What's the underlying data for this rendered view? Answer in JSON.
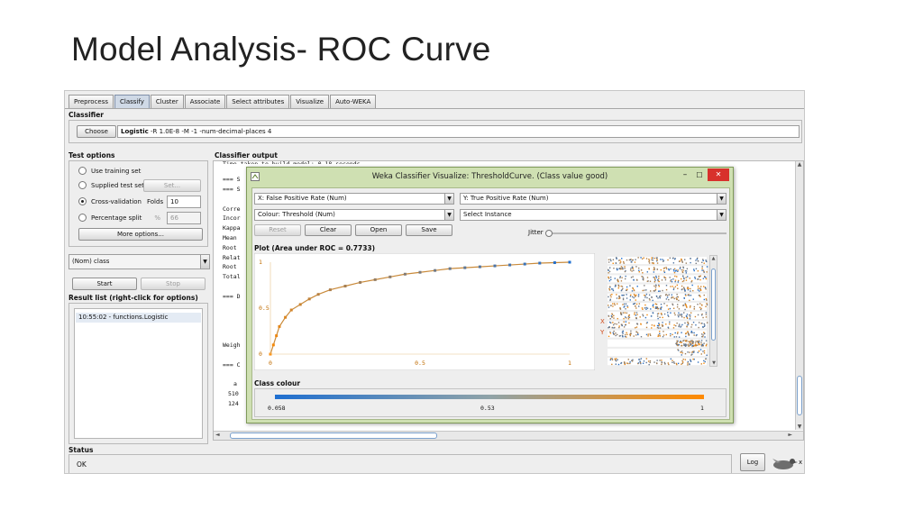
{
  "slide": {
    "title": "Model Analysis- ROC Curve"
  },
  "explorer": {
    "tabs": [
      "Preprocess",
      "Classify",
      "Cluster",
      "Associate",
      "Select attributes",
      "Visualize",
      "Auto-WEKA"
    ],
    "classifier": {
      "section_label": "Classifier",
      "choose_label": "Choose",
      "name": "Logistic",
      "options": " -R 1.0E-8 -M -1 -num-decimal-places 4"
    },
    "test_options": {
      "section_label": "Test options",
      "use_training": "Use training set",
      "supplied": "Supplied test set",
      "set_label": "Set...",
      "cross_validation": "Cross-validation",
      "folds_label": "Folds",
      "folds_value": "10",
      "percentage": "Percentage split",
      "percent_sign": "%",
      "percentage_value": "66",
      "more_options": "More options..."
    },
    "class_select": "(Nom) class",
    "start_label": "Start",
    "stop_label": "Stop",
    "result_list": {
      "section_label": "Result list (right-click for options)",
      "items": [
        "10:55:02 - functions.Logistic"
      ]
    },
    "output": {
      "section_label": "Classifier output",
      "lines": [
        "Time taken to build model: 0.18 seconds",
        "=== S",
        "=== S",
        "Corre",
        "Incor",
        "Kappa",
        "Mean ",
        "Root ",
        "Relat",
        "Root ",
        "Total",
        "=== D",
        "Weigh",
        "=== C",
        "a",
        "510",
        "124"
      ]
    },
    "status": {
      "section_label": "Status",
      "text": "OK",
      "log_label": "Log",
      "x_label": "x"
    }
  },
  "visualizer": {
    "title": "Weka Classifier Visualize: ThresholdCurve. (Class value good)",
    "x_axis_select": "X: False Positive Rate (Num)",
    "y_axis_select": "Y: True Positive Rate (Num)",
    "colour_select": "Colour: Threshold (Num)",
    "instance_select": "Select Instance",
    "buttons": {
      "reset": "Reset",
      "clear": "Clear",
      "open": "Open",
      "save": "Save"
    },
    "jitter_label": "Jitter",
    "plot_label": "Plot (Area under ROC = 0.7733)",
    "side_x": "X",
    "side_y": "Y",
    "class_colour_label": "Class colour",
    "colour_ticks": [
      "0.058",
      "0.53",
      "1"
    ],
    "minimize_glyph": "–",
    "maximize_glyph": "☐",
    "close_glyph": "✕",
    "colors": {
      "low": "#1f6fd0",
      "high": "#ff8a00",
      "close": "#d8312b"
    }
  },
  "chart_data": {
    "type": "scatter",
    "title": "Plot (Area under ROC = 0.7733)",
    "xlabel": "",
    "ylabel": "",
    "xlim": [
      0,
      1
    ],
    "ylim": [
      0,
      1
    ],
    "x_ticks": [
      "0",
      "0.5",
      "1"
    ],
    "y_ticks": [
      "0",
      "0.5",
      "1"
    ],
    "color_by": "Threshold",
    "color_range": [
      0.058,
      1
    ],
    "series": [
      {
        "x": [
          0.0,
          0.01,
          0.02,
          0.03,
          0.05,
          0.07,
          0.1,
          0.13,
          0.16,
          0.2,
          0.25,
          0.3,
          0.35,
          0.4,
          0.45,
          0.5,
          0.55,
          0.6,
          0.65,
          0.7,
          0.75,
          0.8,
          0.85,
          0.9,
          0.95,
          1.0
        ],
        "y": [
          0.0,
          0.1,
          0.2,
          0.3,
          0.4,
          0.48,
          0.54,
          0.6,
          0.65,
          0.7,
          0.74,
          0.78,
          0.81,
          0.84,
          0.87,
          0.89,
          0.91,
          0.93,
          0.94,
          0.95,
          0.96,
          0.97,
          0.98,
          0.99,
          0.995,
          1.0
        ]
      }
    ]
  }
}
